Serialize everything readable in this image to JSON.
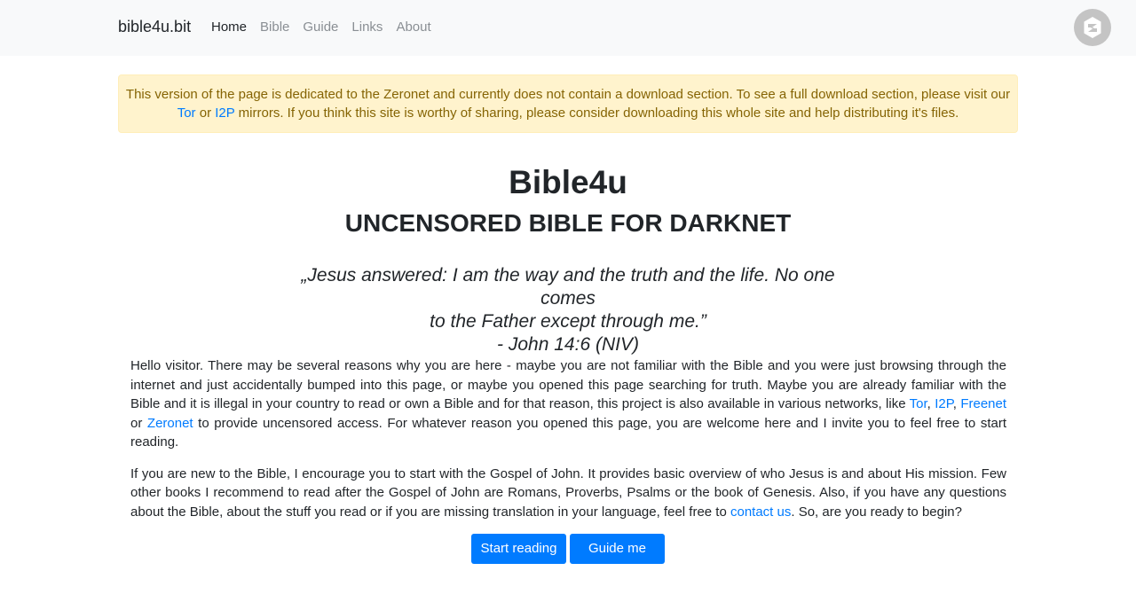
{
  "navbar": {
    "brand": "bible4u.bit",
    "links": [
      "Home",
      "Bible",
      "Guide",
      "Links",
      "About"
    ],
    "active": "Home"
  },
  "alert": {
    "text_1": "This version of the page is dedicated to the Zeronet and currently does not contain a download section. To see a full download section, please visit our ",
    "link_tor": "Tor",
    "text_2": " or ",
    "link_i2p": "I2P",
    "text_3": " mirrors. If you think this site is worthy of sharing, please consider downloading this whole site and help distributing it's files."
  },
  "hero": {
    "title": "Bible4u",
    "subtitle": "UNCENSORED BIBLE FOR DARKNET"
  },
  "quote": {
    "line_1": "„Jesus answered: I am the way and the truth and the life. No one comes",
    "line_2": "to the Father except through me.”",
    "line_3": "- John 14:6 (NIV)"
  },
  "content": {
    "p1_text": "Hello visitor. There may be several reasons why you are here - maybe you are not familiar with the Bible and you were just browsing through the internet and just accidentally bumped into this page, or maybe you opened this page searching for truth. Maybe you are already familiar with the Bible and it is illegal in your country to read or own a Bible and for that reason, this project is also available in various networks, like ",
    "link_tor": "Tor",
    "sep_1": ", ",
    "link_i2p": "I2P",
    "sep_2": ", ",
    "link_freenet": "Freenet",
    "sep_3": " or ",
    "link_zeronet": "Zeronet",
    "p1_end": " to provide uncensored access. For whatever reason you opened this page, you are welcome here and I invite you to feel free to start reading.",
    "p2_text": "If you are new to the Bible, I encourage you to start with the Gospel of John. It provides basic overview of who Jesus is and about His mission. Few other books I recommend to read after the Gospel of John are Romans, Proverbs, Psalms or the book of Genesis. Also, if you have any questions about the Bible, about the stuff you read or if you are missing translation in your language, feel free to ",
    "link_contact": "contact us",
    "p2_end": ". So, are you ready to begin?"
  },
  "buttons": {
    "start": "Start reading",
    "guide": "Guide me"
  },
  "icons": {
    "zeronet": "zeronet-logo-icon"
  },
  "colors": {
    "link": "#007bff",
    "button": "#007bff",
    "alert_bg": "#fff3cd",
    "alert_text": "#856404"
  }
}
